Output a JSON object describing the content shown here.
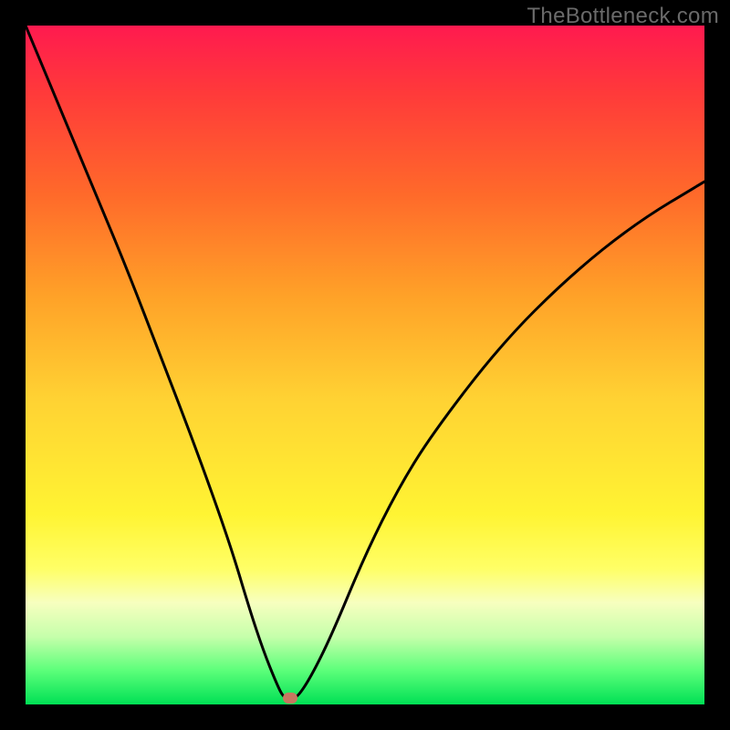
{
  "watermark": "TheBottleneck.com",
  "chart_data": {
    "type": "line",
    "title": "",
    "xlabel": "",
    "ylabel": "",
    "xlim": [
      0,
      100
    ],
    "ylim": [
      0,
      100
    ],
    "background_gradient": {
      "top_color": "#ff1a4f",
      "bottom_color": "#00e055",
      "meaning": "red = high bottleneck, green = low bottleneck"
    },
    "series": [
      {
        "name": "bottleneck-curve",
        "x": [
          0,
          5,
          10,
          15,
          20,
          25,
          30,
          33,
          35,
          37,
          38,
          39,
          40,
          42,
          45,
          50,
          55,
          60,
          70,
          80,
          90,
          100
        ],
        "values": [
          100,
          88,
          76,
          64,
          51,
          38,
          24,
          14,
          8,
          3,
          1,
          1,
          1,
          4,
          10,
          22,
          32,
          40,
          53,
          63,
          71,
          77
        ]
      }
    ],
    "marker": {
      "name": "optimal-point",
      "x": 39,
      "y": 1,
      "color": "#c77760"
    }
  }
}
